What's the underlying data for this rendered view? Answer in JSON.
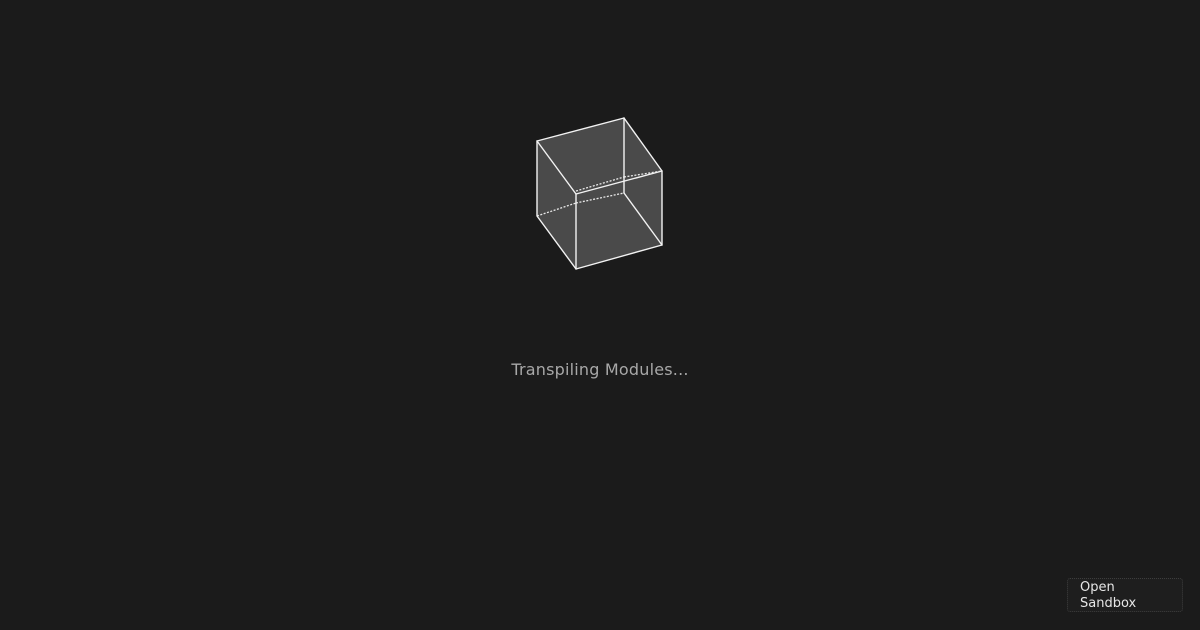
{
  "loader": {
    "icon": "codesandbox-cube-icon",
    "status_text": "Transpiling Modules..."
  },
  "actions": {
    "open_sandbox_line1": "Open",
    "open_sandbox_line2": "Sandbox"
  },
  "colors": {
    "background": "#1b1b1b",
    "cube_fill": "#4a4a4a",
    "cube_edge": "#f0f0f0",
    "status_text": "#a8a8a8",
    "button_text": "#e6e6e6"
  }
}
